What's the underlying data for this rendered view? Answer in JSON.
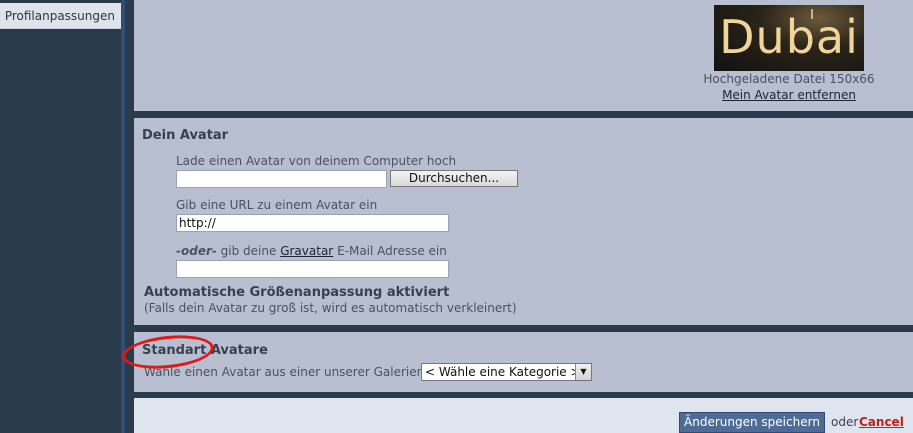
{
  "sidebar": {
    "items": [
      {
        "label": "Profilanpassungen"
      }
    ]
  },
  "current_avatar": {
    "image_text": "Dubai",
    "uploaded_info": "Hochgeladene Datei 150x66",
    "remove_label": "Mein Avatar entfernen"
  },
  "your_avatar": {
    "title": "Dein Avatar",
    "upload_label": "Lade einen Avatar von deinem Computer hoch",
    "upload_value": "",
    "browse_label": "Durchsuchen...",
    "url_label": "Gib eine URL zu einem Avatar ein",
    "url_value": "http://",
    "gravatar_or": "-oder-",
    "gravatar_pre": " gib deine ",
    "gravatar_link": "Gravatar",
    "gravatar_post": " E-Mail Adresse ein",
    "gravatar_value": "",
    "resize_title": "Automatische Größenanpassung aktiviert",
    "resize_note": "(Falls dein Avatar zu groß ist, wird es automatisch verkleinert)"
  },
  "standard_avatars": {
    "title": "Standart Avatare",
    "label": "Wähle einen Avatar aus einer unserer Galerien:",
    "select_value": "< Wähle eine Kategorie >"
  },
  "actions": {
    "save_label": "Änderungen speichern",
    "or_text": "oder",
    "cancel_label": "Cancel"
  },
  "colors": {
    "panel": "#b7bfd1",
    "background": "#2b3b4e",
    "accent_button": "#4f6c97",
    "cancel": "#c0201b",
    "annotation": "#e01818"
  }
}
